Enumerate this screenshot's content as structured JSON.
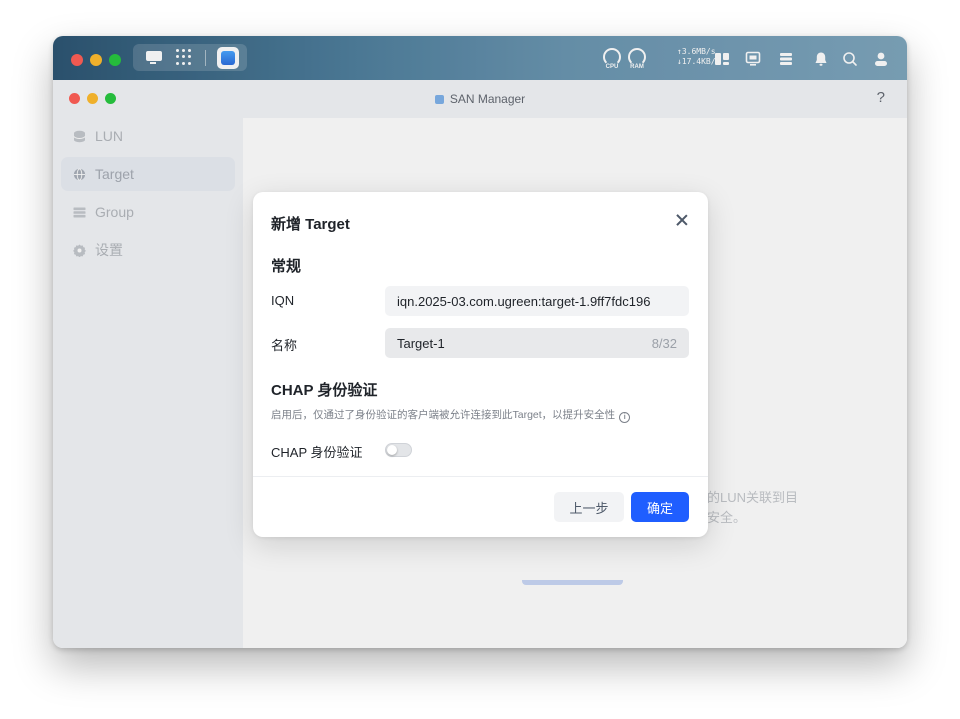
{
  "system_bar": {
    "cpu_label": "CPU",
    "ram_label": "RAM",
    "upload_speed": "↑3.6MB/s",
    "download_speed": "↓17.4KB/s"
  },
  "window": {
    "title": "SAN Manager",
    "help": "?"
  },
  "sidebar": {
    "items": [
      {
        "label": "LUN",
        "icon": "database-icon"
      },
      {
        "label": "Target",
        "icon": "globe-icon"
      },
      {
        "label": "Group",
        "icon": "list-icon"
      },
      {
        "label": "设置",
        "icon": "gear-icon"
      }
    ]
  },
  "background": {
    "text_line1": "的LUN关联到目",
    "text_line2": "安全。"
  },
  "modal": {
    "title": "新增 Target",
    "section_general": "常规",
    "iqn_label": "IQN",
    "iqn_value": "iqn.2025-03.com.ugreen:target-1.9ff7fdc196",
    "name_label": "名称",
    "name_value": "Target-1",
    "name_count": "8/32",
    "section_chap": "CHAP 身份验证",
    "chap_desc": "启用后，仅通过了身份验证的客户端被允许连接到此Target，以提升安全性",
    "chap_toggle_label": "CHAP 身份验证",
    "chap_enabled": false,
    "prev_button": "上一步",
    "ok_button": "确定"
  },
  "colors": {
    "accent": "#1f5eff",
    "sysbar_start": "#2d5673",
    "sysbar_end": "#7fa6bd"
  }
}
